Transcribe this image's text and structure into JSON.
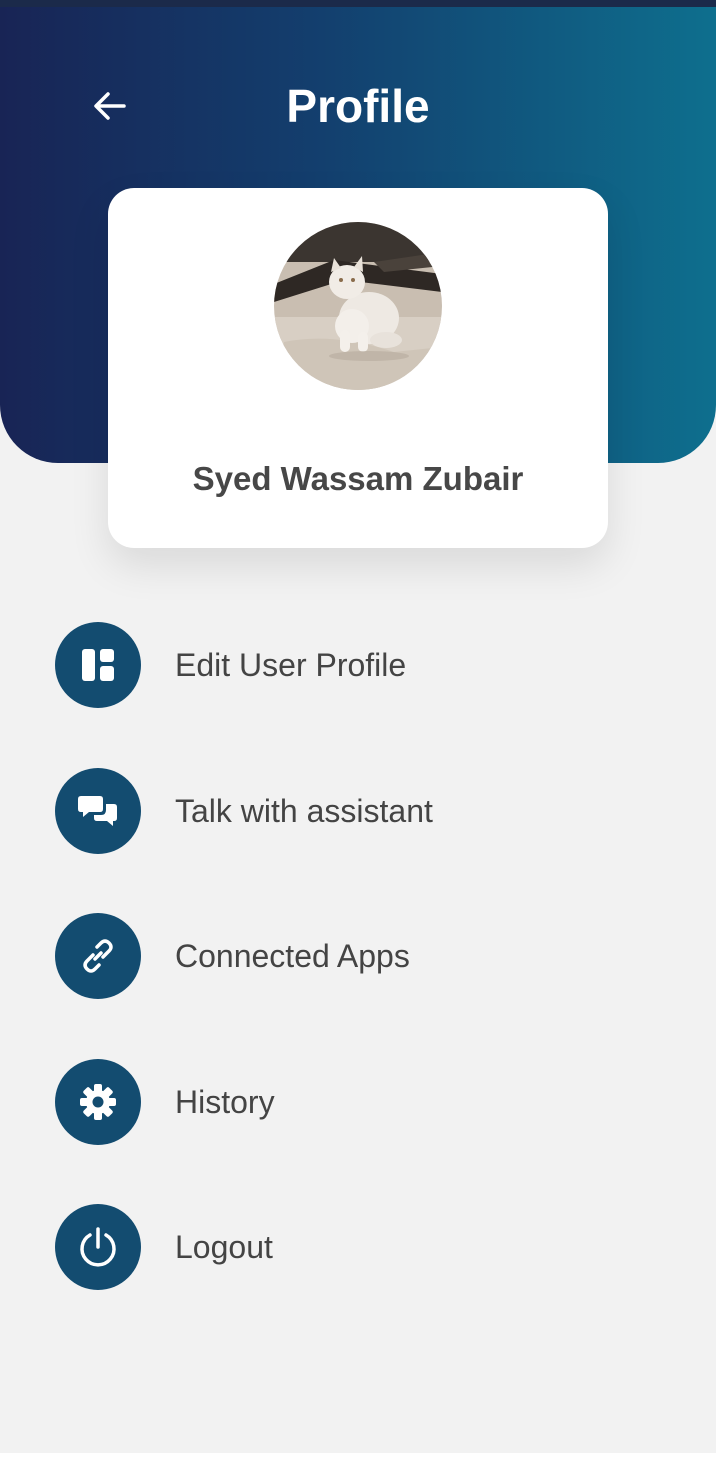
{
  "header": {
    "title": "Profile",
    "back_icon": "arrow-left-icon",
    "gradient": [
      "#182455",
      "#0e6f8e"
    ]
  },
  "profile": {
    "name": "Syed Wassam Zubair",
    "avatar_alt": "profile-photo"
  },
  "menu": {
    "items": [
      {
        "label": "Edit User Profile",
        "icon": "dashboard-icon"
      },
      {
        "label": "Talk with assistant",
        "icon": "chat-bubbles-icon"
      },
      {
        "label": "Connected Apps",
        "icon": "link-icon"
      },
      {
        "label": "History",
        "icon": "gear-icon"
      },
      {
        "label": "Logout",
        "icon": "power-icon"
      }
    ]
  },
  "colors": {
    "accent": "#134c70",
    "background": "#f2f2f2",
    "text": "#444444"
  }
}
